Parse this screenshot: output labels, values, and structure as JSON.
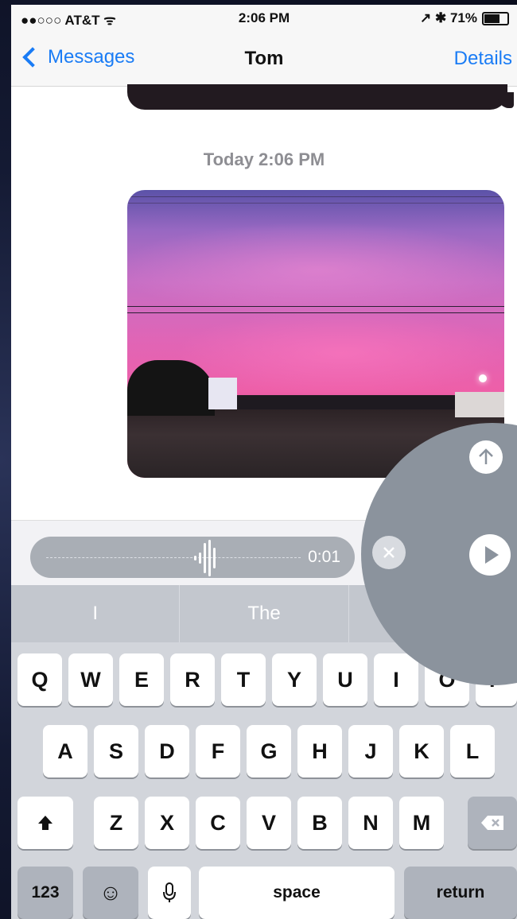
{
  "status": {
    "carrier": "●●○○○ AT&T",
    "wifi": "ᯤ",
    "time": "2:06 PM",
    "right": "↗ ✱ 71%"
  },
  "nav": {
    "back": "Messages",
    "title": "Tom",
    "details": "Details"
  },
  "conversation": {
    "timestamp": "Today 2:06 PM"
  },
  "audio": {
    "duration": "0:01"
  },
  "suggestions": [
    "I",
    "The",
    ""
  ],
  "keyboard": {
    "row1": [
      "Q",
      "W",
      "E",
      "R",
      "T",
      "Y",
      "U",
      "I",
      "O",
      "P"
    ],
    "row2": [
      "A",
      "S",
      "D",
      "F",
      "G",
      "H",
      "J",
      "K",
      "L"
    ],
    "row3": [
      "Z",
      "X",
      "C",
      "V",
      "B",
      "N",
      "M"
    ],
    "numbers": "123",
    "space": "space",
    "return": "return"
  },
  "colors": {
    "accent": "#1a7cf5",
    "control_circle": "#8b939d"
  }
}
